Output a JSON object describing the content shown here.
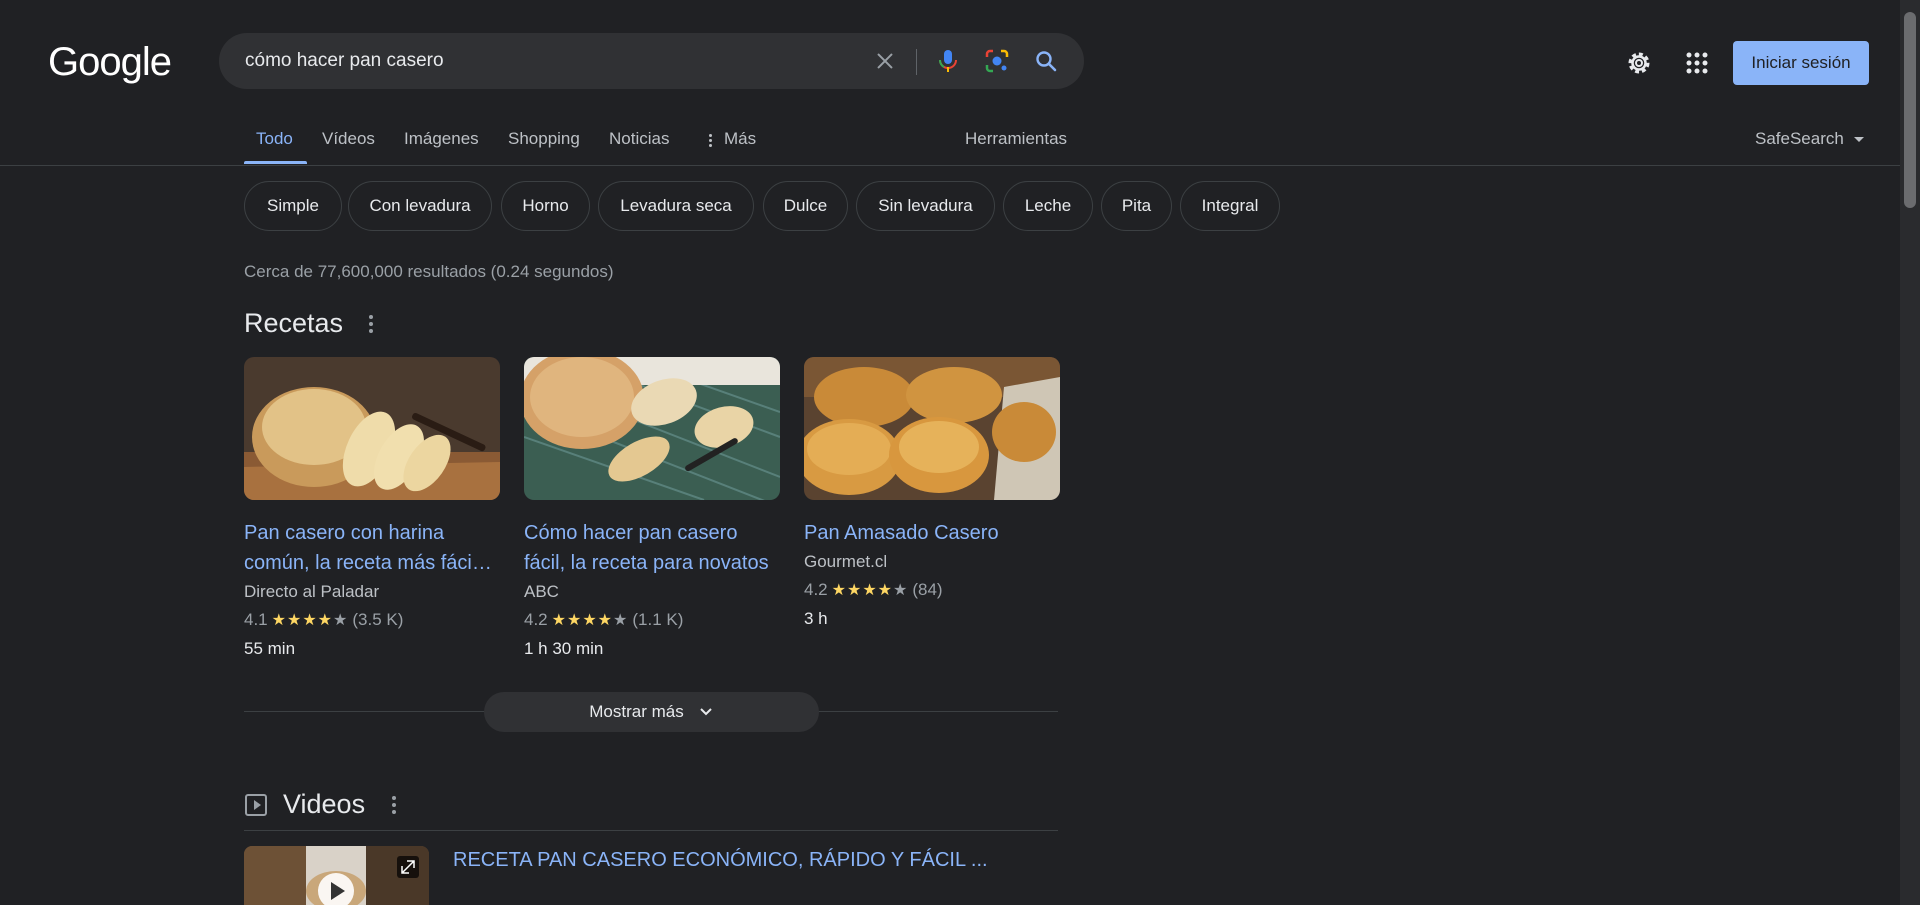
{
  "logo": "Google",
  "search": {
    "query": "cómo hacer pan casero"
  },
  "header": {
    "signin_label": "Iniciar sesión"
  },
  "tabs": [
    {
      "label": "Todo",
      "active": true
    },
    {
      "label": "Vídeos"
    },
    {
      "label": "Imágenes"
    },
    {
      "label": "Shopping"
    },
    {
      "label": "Noticias"
    },
    {
      "label": "Más"
    }
  ],
  "tools_label": "Herramientas",
  "safesearch_label": "SafeSearch",
  "chips": [
    "Simple",
    "Con levadura",
    "Horno",
    "Levadura seca",
    "Dulce",
    "Sin levadura",
    "Leche",
    "Pita",
    "Integral"
  ],
  "stats": "Cerca de 77,600,000 resultados (0.24 segundos)",
  "recipes": {
    "title": "Recetas",
    "items": [
      {
        "title": "Pan casero con harina común, la receta más fáci…",
        "source": "Directo al Paladar",
        "rating": "4.1",
        "stars": 4,
        "reviews": "(3.5 K)",
        "time": "55 min"
      },
      {
        "title": "Cómo hacer pan casero fácil, la receta para novatos",
        "source": "ABC",
        "rating": "4.2",
        "stars": 4,
        "reviews": "(1.1 K)",
        "time": "1 h 30 min"
      },
      {
        "title": "Pan Amasado Casero",
        "source": "Gourmet.cl",
        "rating": "4.2",
        "stars": 4,
        "reviews": "(84)",
        "time": "3 h"
      }
    ],
    "more_label": "Mostrar más"
  },
  "videos": {
    "title": "Videos",
    "first_title": "RECETA PAN CASERO ECONÓMICO, RÁPIDO Y FÁCIL ..."
  },
  "colors": {
    "background": "#202124",
    "link": "#8ab4f8",
    "star": "#fdd663",
    "accent_button": "#8ab4f8"
  }
}
